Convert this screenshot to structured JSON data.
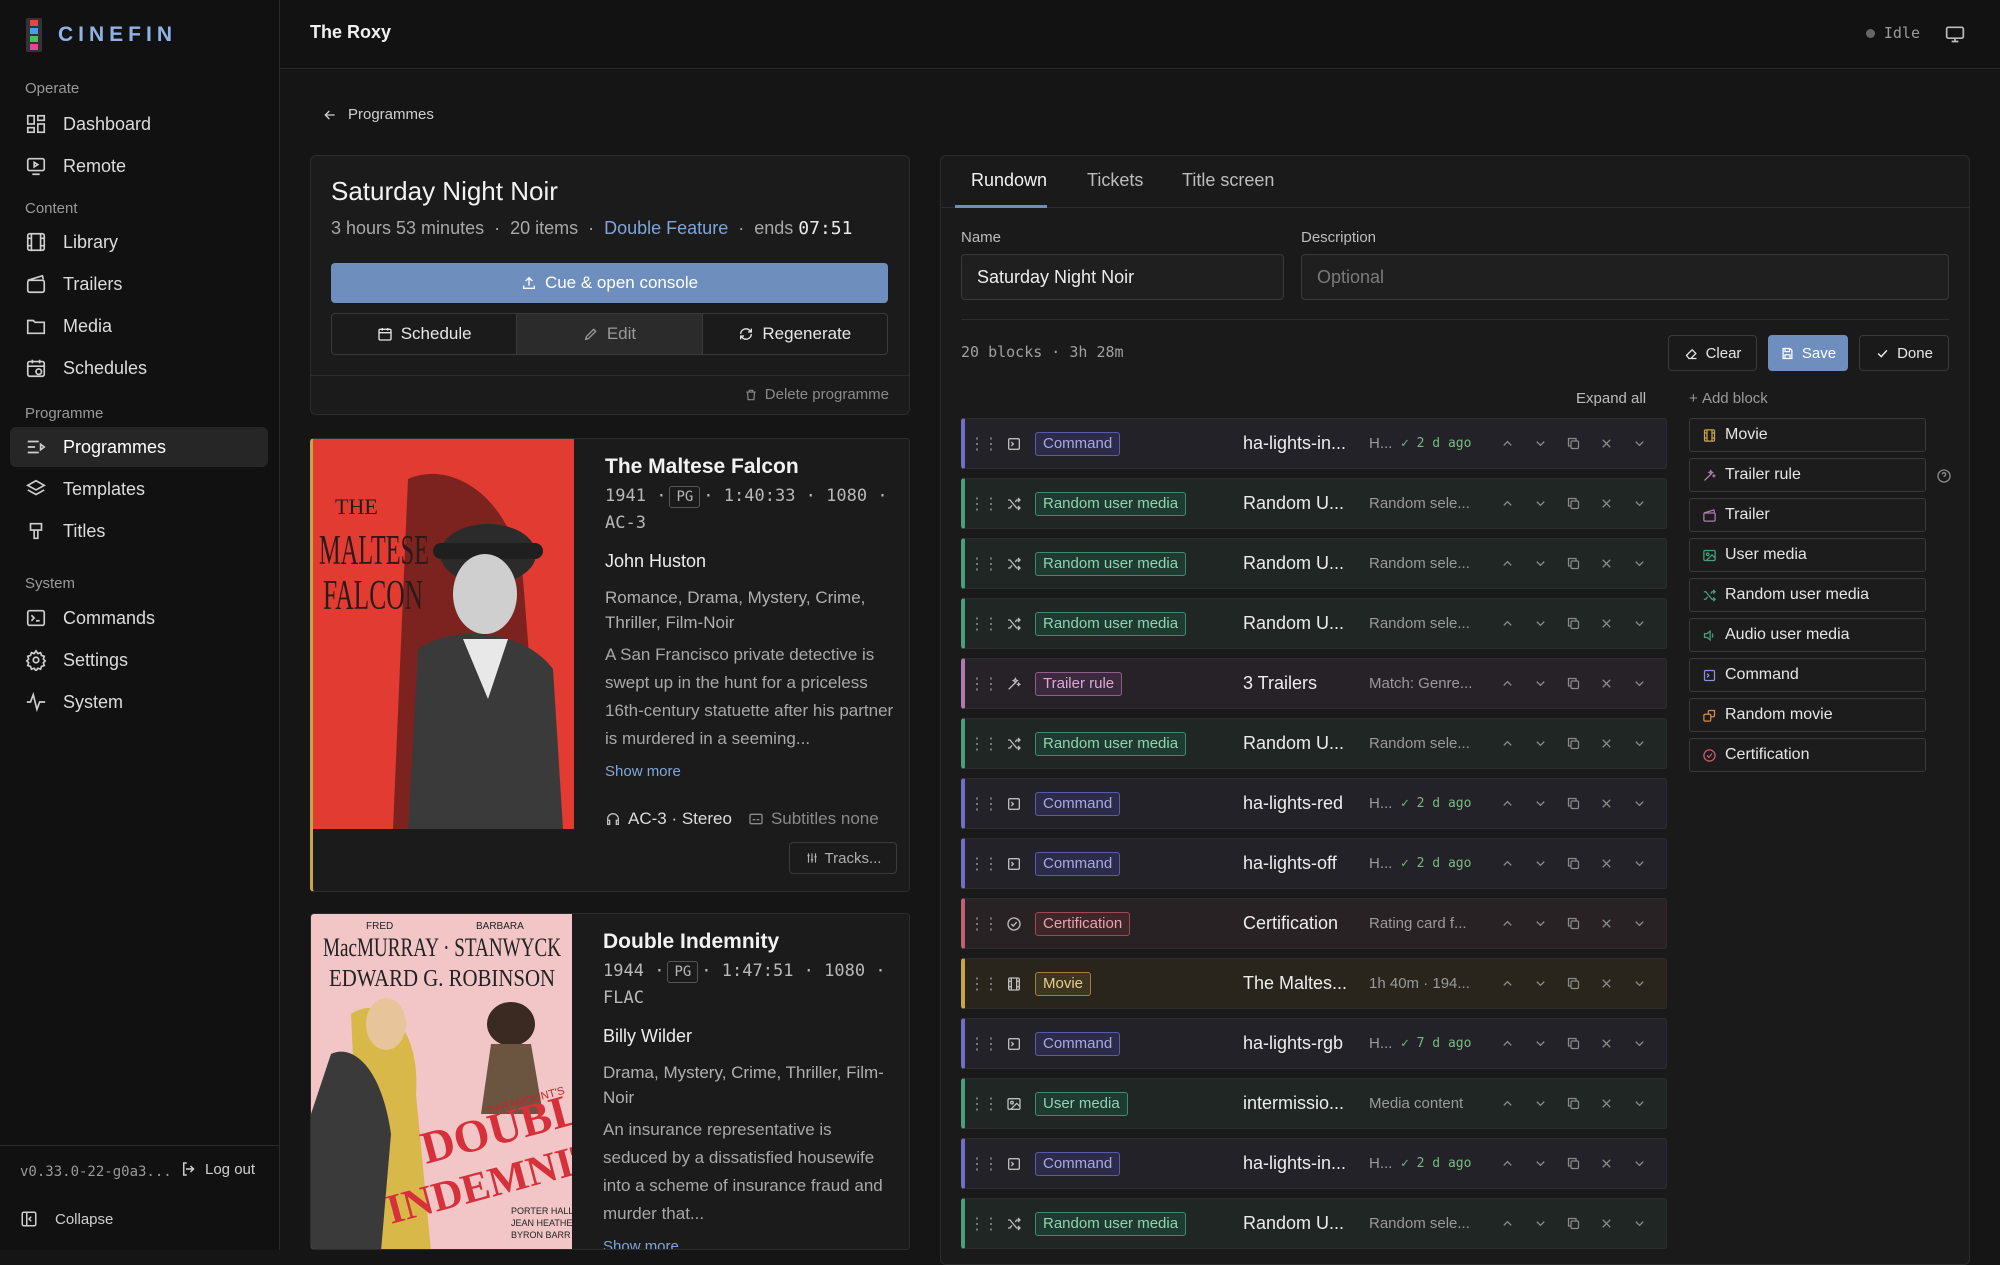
{
  "app": {
    "name": "CINEFIN",
    "version": "v0.33.0-22-g0a3...",
    "logout": "Log out",
    "collapse": "Collapse"
  },
  "sidebar": {
    "sections": [
      {
        "label": "Operate",
        "items": [
          {
            "label": "Dashboard",
            "icon": "dashboard-icon"
          },
          {
            "label": "Remote",
            "icon": "remote-icon"
          }
        ]
      },
      {
        "label": "Content",
        "items": [
          {
            "label": "Library",
            "icon": "library-icon"
          },
          {
            "label": "Trailers",
            "icon": "trailers-icon"
          },
          {
            "label": "Media",
            "icon": "media-icon"
          },
          {
            "label": "Schedules",
            "icon": "schedules-icon"
          }
        ]
      },
      {
        "label": "Programme",
        "items": [
          {
            "label": "Programmes",
            "icon": "programmes-icon",
            "active": true
          },
          {
            "label": "Templates",
            "icon": "templates-icon"
          },
          {
            "label": "Titles",
            "icon": "titles-icon"
          }
        ]
      },
      {
        "label": "System",
        "items": [
          {
            "label": "Commands",
            "icon": "commands-icon"
          },
          {
            "label": "Settings",
            "icon": "settings-icon"
          },
          {
            "label": "System",
            "icon": "system-icon"
          }
        ]
      }
    ]
  },
  "topbar": {
    "venue": "The Roxy",
    "status": "Idle"
  },
  "breadcrumb": {
    "back": "Programmes"
  },
  "programme": {
    "title": "Saturday Night Noir",
    "duration": "3 hours 53 minutes",
    "items": "20 items",
    "format": "Double Feature",
    "ends_label": "ends",
    "ends_time": "07:51",
    "cue_button": "Cue & open console",
    "schedule_button": "Schedule",
    "edit_button": "Edit",
    "regenerate_button": "Regenerate",
    "delete_button": "Delete programme"
  },
  "films": [
    {
      "title": "The Maltese Falcon",
      "year": "1941",
      "rating": "PG",
      "runtime": "1:40:33",
      "resolution": "1080",
      "audio_codec": "AC-3",
      "director": "John Huston",
      "genres": "Romance, Drama, Mystery, Crime, Thriller, Film-Noir",
      "synopsis": "A San Francisco private detective is swept up in the hunt for a priceless 16th-century statuette after his partner is murdered in a seeming...",
      "show_more": "Show more",
      "audio": "AC-3 · Stereo",
      "subtitles": "Subtitles none",
      "tracks": "Tracks...",
      "poster_text": [
        "THE",
        "MALTESE",
        "FALCON"
      ]
    },
    {
      "title": "Double Indemnity",
      "year": "1944",
      "rating": "PG",
      "runtime": "1:47:51",
      "resolution": "1080",
      "audio_codec": "FLAC",
      "director": "Billy Wilder",
      "genres": "Drama, Mystery, Crime, Thriller, Film-Noir",
      "synopsis": "An insurance representative is seduced by a dissatisfied housewife into a scheme of insurance fraud and murder that...",
      "show_more": "Show more",
      "poster_text": [
        "FRED",
        "BARBARA",
        "MacMURRAY · STANWYCK",
        "EDWARD G. ROBINSON",
        "PARAMOUNT'S",
        "DOUBLE",
        "INDEMNITY",
        "PORTER HALL",
        "JEAN HEATHER",
        "BYRON BARR"
      ]
    }
  ],
  "editor": {
    "tabs": [
      "Rundown",
      "Tickets",
      "Title screen"
    ],
    "name_label": "Name",
    "name_value": "Saturday Night Noir",
    "description_label": "Description",
    "description_placeholder": "Optional",
    "blocks_info": "20 blocks · 3h 28m",
    "clear": "Clear",
    "save": "Save",
    "done": "Done",
    "expand_all": "Expand all",
    "add_block": "Add block"
  },
  "rundown": [
    {
      "type": "Command",
      "title": "ha-lights-in...",
      "desc": "H...",
      "ago": "✓ 2 d ago"
    },
    {
      "type": "Random user media",
      "title": "Random U...",
      "desc": "Random sele..."
    },
    {
      "type": "Random user media",
      "title": "Random U...",
      "desc": "Random sele..."
    },
    {
      "type": "Random user media",
      "title": "Random U...",
      "desc": "Random sele..."
    },
    {
      "type": "Trailer rule",
      "title": "3 Trailers",
      "desc": "Match: Genre..."
    },
    {
      "type": "Random user media",
      "title": "Random U...",
      "desc": "Random sele..."
    },
    {
      "type": "Command",
      "title": "ha-lights-red",
      "desc": "H...",
      "ago": "✓ 2 d ago"
    },
    {
      "type": "Command",
      "title": "ha-lights-off",
      "desc": "H...",
      "ago": "✓ 2 d ago"
    },
    {
      "type": "Certification",
      "title": "Certification",
      "desc": "Rating card f..."
    },
    {
      "type": "Movie",
      "title": "The Maltes...",
      "desc": "1h 40m · 194..."
    },
    {
      "type": "Command",
      "title": "ha-lights-rgb",
      "desc": "H...",
      "ago": "✓ 7 d ago"
    },
    {
      "type": "User media",
      "title": "intermissio...",
      "desc": "Media content"
    },
    {
      "type": "Command",
      "title": "ha-lights-in...",
      "desc": "H...",
      "ago": "✓ 2 d ago"
    },
    {
      "type": "Random user media",
      "title": "Random U...",
      "desc": "Random sele..."
    }
  ],
  "palette": [
    "Movie",
    "Trailer rule",
    "Trailer",
    "User media",
    "Random user media",
    "Audio user media",
    "Command",
    "Random movie",
    "Certification"
  ],
  "colors": {
    "accent": "#6e8fbd",
    "command": "#6f6fc4",
    "random_user_media": "#4a9e7e",
    "trailer_rule": "#b07ab0",
    "certification": "#c0626e",
    "movie": "#c7a54a",
    "user_media": "#4a9e7e"
  }
}
